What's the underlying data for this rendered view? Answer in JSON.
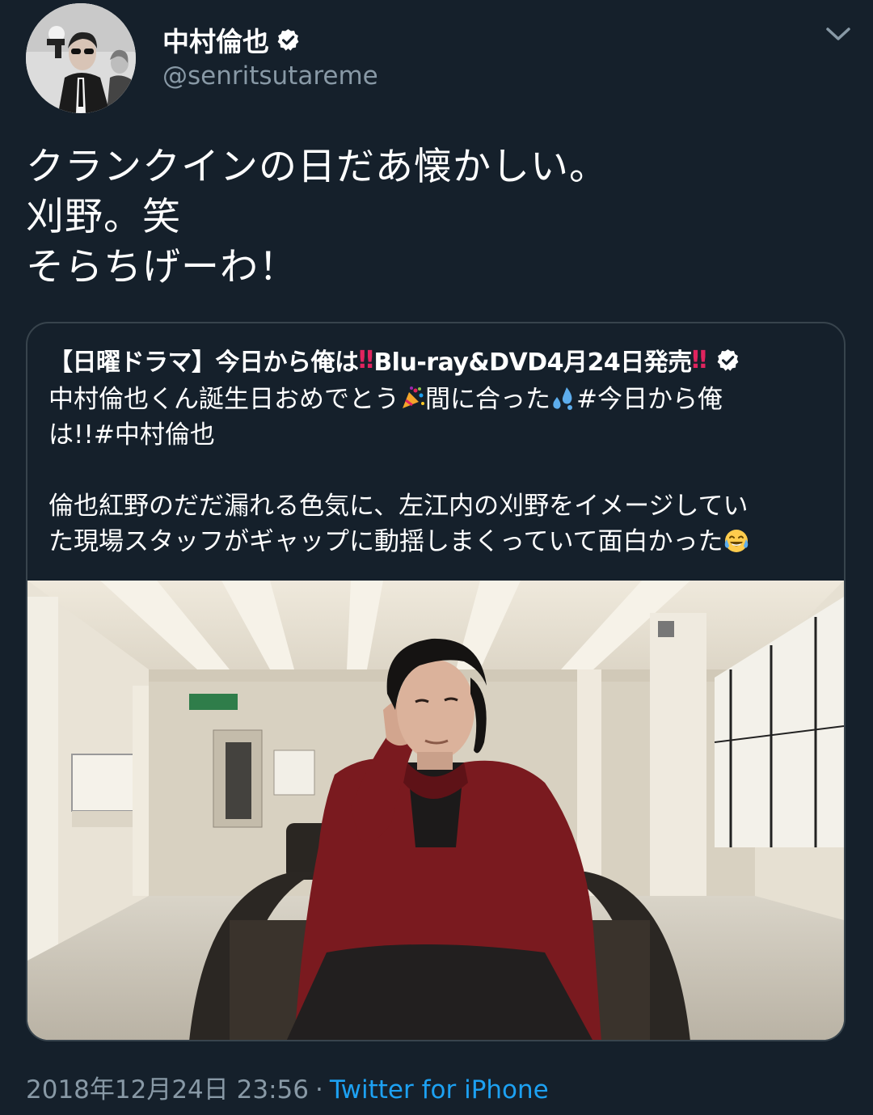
{
  "author": {
    "display_name": "中村倫也",
    "handle": "@senritsutareme",
    "verified": true
  },
  "tweet_text": {
    "line1": "クランクインの日だあ懐かしい。",
    "line2": "刈野。笑",
    "line3": "そらちげーわ！"
  },
  "quoted_tweet": {
    "account_name_part1": "【日曜ドラマ】今日から俺は",
    "account_name_part2": "Blu-ray&DVD4月24日発売",
    "bang": "‼",
    "verified": true,
    "body_line1_a": "中村倫也くん誕生日おめでとう",
    "body_line1_b": "間に合った",
    "body_line1_c": "#今日から俺",
    "body_line2": "は!!#中村倫也",
    "body_line3": "倫也紅野のだだ漏れる色気に、左江内の刈野をイメージしてい",
    "body_line4": "た現場スタッフがギャップに動揺しまくっていて面白かった",
    "emoji_1": "party-popper-icon",
    "emoji_2": "sweat-droplets-icon",
    "emoji_3": "tears-of-joy-icon",
    "photo": "photo-man-in-red-shirt-seated-in-empty-office"
  },
  "footer": {
    "timestamp": "2018年12月24日 23:56",
    "separator": "·",
    "source": "Twitter for iPhone"
  },
  "colors": {
    "background": "#15202b",
    "secondary_text": "#8899a6",
    "link": "#1da1f2",
    "card_border": "#38444d",
    "accent_red": "#e0245e"
  }
}
